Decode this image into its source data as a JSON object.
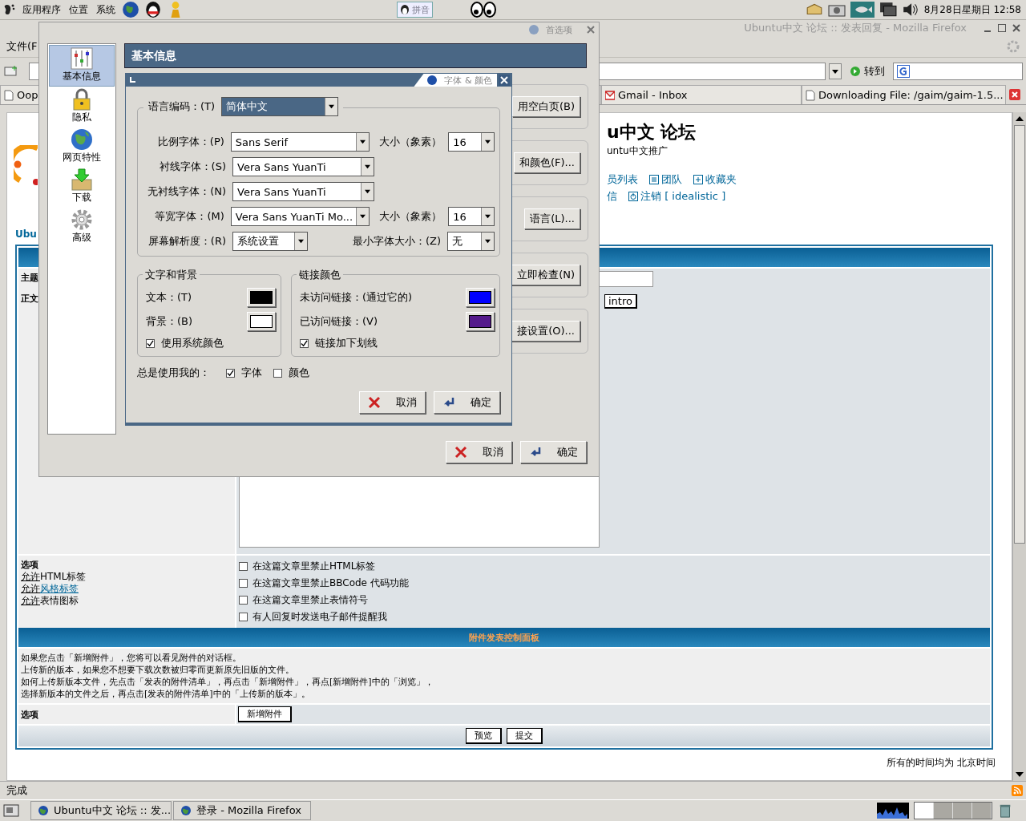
{
  "top_panel": {
    "menus": [
      "应用程序",
      "位置",
      "系统"
    ],
    "ime": "拼音",
    "clock": "8月28日星期日 12:58"
  },
  "firefox": {
    "title": "Ubuntu中文 论坛 :: 发表回复 - Mozilla Firefox",
    "menu": [
      "文件(F"
    ],
    "go_label": "转到",
    "tabs": [
      {
        "label": "Oop"
      },
      {
        "label": "Gmail - Inbox"
      },
      {
        "label": "Downloading File: /gaim/gaim-1.5..."
      }
    ],
    "status": "完成"
  },
  "page": {
    "title": "u中文 论坛",
    "subtitle": "untu中文推广",
    "nav": [
      {
        "label": "员列表",
        "kind": "plain"
      },
      {
        "label": "团队",
        "kind": "list"
      },
      {
        "label": "收藏夹",
        "kind": "plus"
      }
    ],
    "nav2": [
      {
        "label": "信",
        "kind": "plain"
      },
      {
        "label": "注销 [ idealistic ]",
        "kind": "power"
      }
    ],
    "brand": "Ubu",
    "subject_label": "主题",
    "body_label": "正文",
    "intro_button": "intro",
    "options_label": "选项",
    "options_info": [
      {
        "prefix": "允许",
        "text": "HTML标签",
        "link": false
      },
      {
        "prefix": "允许",
        "text": "风格标签",
        "link": true
      },
      {
        "prefix": "允许",
        "text": "表情图标",
        "link": false
      }
    ],
    "options": [
      {
        "label": "在这篇文章里禁止HTML标签",
        "checked": false
      },
      {
        "label": "在这篇文章里禁止BBCode 代码功能",
        "checked": false
      },
      {
        "label": "在这篇文章里禁止表情符号",
        "checked": false
      },
      {
        "label": "有人回复时发送电子邮件提醒我",
        "checked": false
      }
    ],
    "attach_header": "附件发表控制面板",
    "attach_help": [
      "如果您点击「新增附件」，您将可以看见附件的对话框。",
      "上传新的版本，如果您不想要下载次数被归零而更新原先旧版的文件。",
      "如何上传新版本文件，先点击「发表的附件清单」，再点击「新增附件」，再点[新增附件]中的「浏览」，",
      "选择新版本的文件之后，再点击[发表的附件清单]中的「上传新的版本」。"
    ],
    "attach_options_label": "选项",
    "add_attachment": "新增附件",
    "preview": "预览",
    "submit": "提交",
    "timezone": "所有的时间均为 北京时间"
  },
  "prefs": {
    "title": "首选项",
    "categories": [
      {
        "label": "基本信息",
        "kind": "general",
        "selected": true
      },
      {
        "label": "隐私",
        "kind": "lock",
        "selected": false
      },
      {
        "label": "网页特性",
        "kind": "globe",
        "selected": false
      },
      {
        "label": "下载",
        "kind": "download",
        "selected": false
      },
      {
        "label": "高级",
        "kind": "gear",
        "selected": false
      }
    ],
    "header": "基本信息",
    "side_buttons": [
      "用空白页(B)",
      "和颜色(F)...",
      "语言(L)...",
      "立即检查(N)",
      "接设置(O)..."
    ],
    "cancel": "取消",
    "ok": "确定"
  },
  "fonts": {
    "title": "字体 & 颜色",
    "language_label": "语言编码：(T)",
    "language": "简体中文",
    "rows": [
      {
        "label": "比例字体：(P)",
        "value": "Sans Serif",
        "size_label": "大小（象素）",
        "size": "16"
      },
      {
        "label": "衬线字体：(S)",
        "value": "Vera Sans YuanTi"
      },
      {
        "label": "无衬线字体：(N)",
        "value": "Vera Sans YuanTi"
      },
      {
        "label": "等宽字体：(M)",
        "value": "Vera Sans YuanTi Mo...",
        "size_label": "大小（象素）",
        "size": "16"
      }
    ],
    "resolution_label": "屏幕解析度：(R)",
    "resolution": "系统设置",
    "min_size_label": "最小字体大小：(Z)",
    "min_size": "无",
    "text_bg": {
      "title": "文字和背景",
      "colors": [
        {
          "label": "文本：(T)",
          "color": "#000000"
        },
        {
          "label": "背景：(B)",
          "color": "#ffffff"
        }
      ],
      "check": {
        "label": "使用系统颜色",
        "checked": true
      }
    },
    "links": {
      "title": "链接颜色",
      "colors": [
        {
          "label": "未访问链接：(通过它的)",
          "color": "#0000ff"
        },
        {
          "label": "已访问链接：(V)",
          "color": "#551a8b"
        }
      ],
      "check": {
        "label": "链接加下划线",
        "checked": true
      }
    },
    "always_label": "总是使用我的：",
    "always": [
      {
        "label": "字体",
        "checked": true
      },
      {
        "label": "颜色",
        "checked": false
      }
    ],
    "cancel": "取消",
    "ok": "确定"
  },
  "taskbar": {
    "items": [
      {
        "label": "Ubuntu中文 论坛 :: 发..."
      },
      {
        "label": "登录 - Mozilla Firefox"
      }
    ]
  }
}
